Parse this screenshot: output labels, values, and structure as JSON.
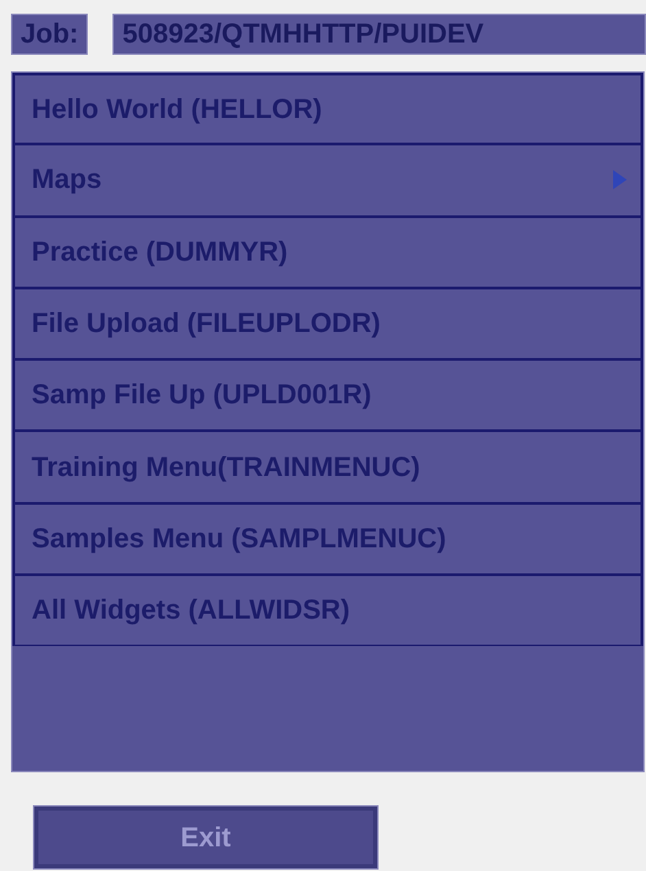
{
  "job": {
    "label": "Job:",
    "value": "508923/QTMHHTTP/PUIDEV"
  },
  "menu": {
    "items": [
      {
        "label": "Hello World (HELLOR)",
        "submenu": false
      },
      {
        "label": "Maps",
        "submenu": true
      },
      {
        "label": "Practice (DUMMYR)",
        "submenu": false
      },
      {
        "label": "File Upload (FILEUPLODR)",
        "submenu": false
      },
      {
        "label": "Samp File Up (UPLD001R)",
        "submenu": false
      },
      {
        "label": "Training Menu(TRAINMENUC)",
        "submenu": false
      },
      {
        "label": "Samples Menu (SAMPLMENUC)",
        "submenu": false
      },
      {
        "label": "All Widgets (ALLWIDSR)",
        "submenu": false
      }
    ]
  },
  "exit_button": {
    "label": "Exit",
    "disabled": true
  }
}
